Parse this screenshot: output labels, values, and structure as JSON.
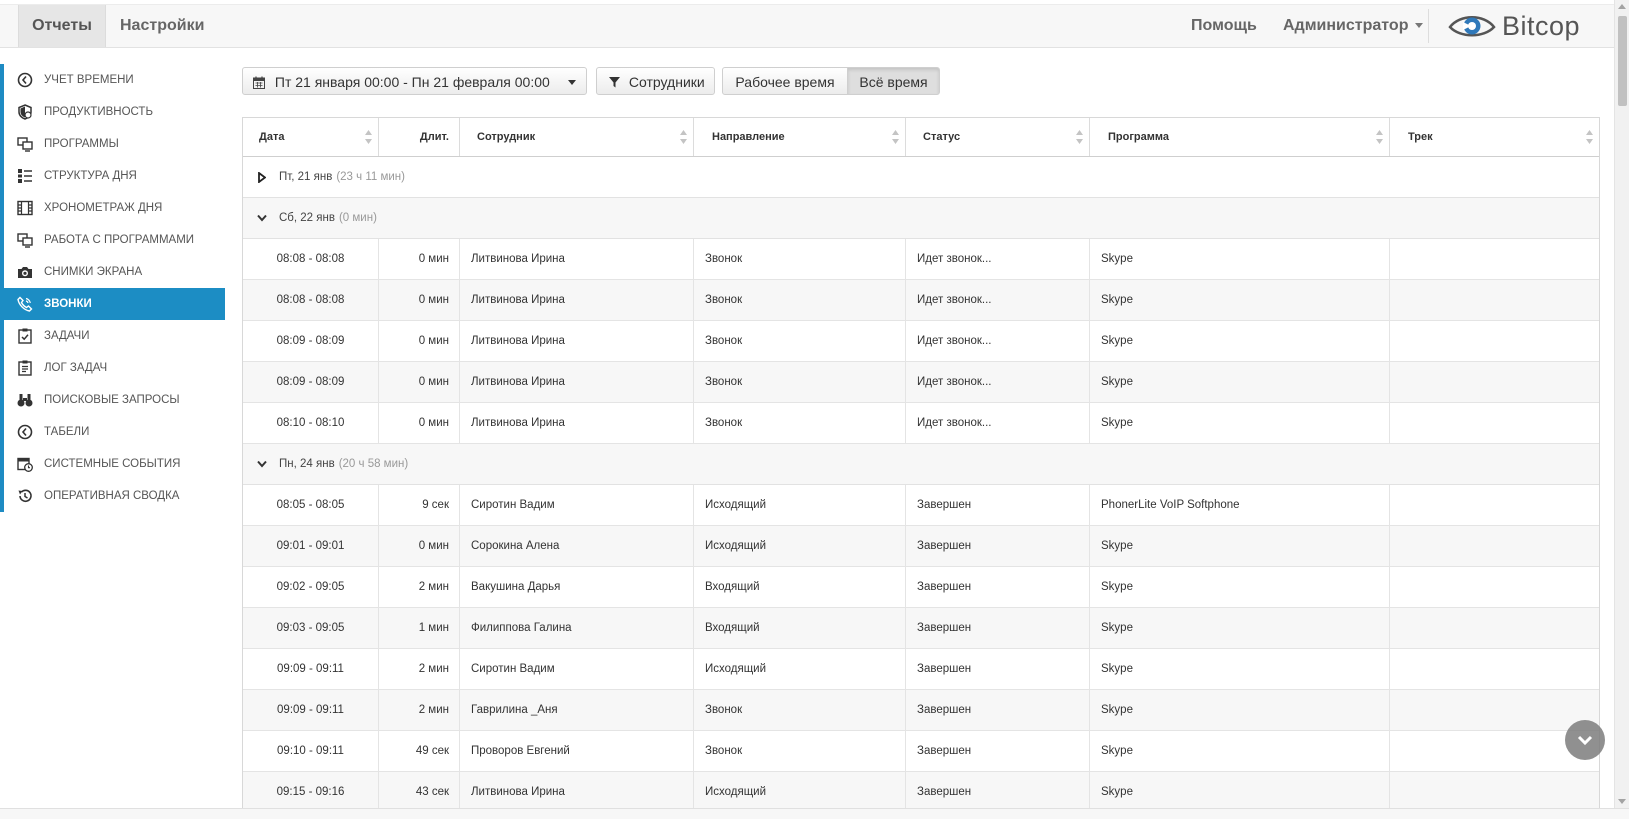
{
  "topnav": {
    "tabs": [
      {
        "label": "Отчеты",
        "active": true
      },
      {
        "label": "Настройки",
        "active": false
      }
    ],
    "help": "Помощь",
    "user": "Администратор",
    "brand": "Bitcop"
  },
  "sidebar": {
    "accent": "#1c8dc4",
    "items": [
      {
        "label": "УЧЕТ ВРЕМЕНИ",
        "icon": "clock-icon"
      },
      {
        "label": "ПРОДУКТИВНОСТЬ",
        "icon": "shield-icon"
      },
      {
        "label": "ПРОГРАММЫ",
        "icon": "monitors-icon"
      },
      {
        "label": "СТРУКТУРА ДНЯ",
        "icon": "structure-icon"
      },
      {
        "label": "ХРОНОМЕТРАЖ ДНЯ",
        "icon": "film-icon"
      },
      {
        "label": "РАБОТА С ПРОГРАММАМИ",
        "icon": "monitors-icon"
      },
      {
        "label": "СНИМКИ ЭКРАНА",
        "icon": "camera-icon"
      },
      {
        "label": "ЗВОНКИ",
        "icon": "phone-icon",
        "active": true
      },
      {
        "label": "ЗАДАЧИ",
        "icon": "checklist-icon"
      },
      {
        "label": "ЛОГ ЗАДАЧ",
        "icon": "task-log-icon"
      },
      {
        "label": "ПОИСКОВЫЕ ЗАПРОСЫ",
        "icon": "binoculars-icon"
      },
      {
        "label": "ТАБЕЛИ",
        "icon": "clock-icon"
      },
      {
        "label": "СИСТЕМНЫЕ СОБЫТИЯ",
        "icon": "calendar-clock-icon"
      },
      {
        "label": "ОПЕРАТИВНАЯ СВОДКА",
        "icon": "history-icon"
      }
    ]
  },
  "filters": {
    "date_range": "Пт 21 января 00:00 - Пн 21 февраля 00:00",
    "employees": "Сотрудники",
    "worktime": "Рабочее время",
    "alltime": "Всё время"
  },
  "table": {
    "columns": [
      "Дата",
      "Длит.",
      "Сотрудник",
      "Направление",
      "Статус",
      "Программа",
      "Трек"
    ],
    "groups": [
      {
        "day": "Пт, 21 янв",
        "total": "(23 ч 11 мин)",
        "expanded": false,
        "rows": []
      },
      {
        "day": "Сб, 22 янв",
        "total": "(0 мин)",
        "expanded": true,
        "rows": [
          [
            "08:08 - 08:08",
            "0 мин",
            "Литвинова Ирина",
            "Звонок",
            "Идет звонок...",
            "Skype",
            ""
          ],
          [
            "08:08 - 08:08",
            "0 мин",
            "Литвинова Ирина",
            "Звонок",
            "Идет звонок...",
            "Skype",
            ""
          ],
          [
            "08:09 - 08:09",
            "0 мин",
            "Литвинова Ирина",
            "Звонок",
            "Идет звонок...",
            "Skype",
            ""
          ],
          [
            "08:09 - 08:09",
            "0 мин",
            "Литвинова Ирина",
            "Звонок",
            "Идет звонок...",
            "Skype",
            ""
          ],
          [
            "08:10 - 08:10",
            "0 мин",
            "Литвинова Ирина",
            "Звонок",
            "Идет звонок...",
            "Skype",
            ""
          ]
        ]
      },
      {
        "day": "Пн, 24 янв",
        "total": "(20 ч 58 мин)",
        "expanded": true,
        "rows": [
          [
            "08:05 - 08:05",
            "9 сек",
            "Сиротин Вадим",
            "Исходящий",
            "Завершен",
            "PhonerLite VoIP Softphone",
            ""
          ],
          [
            "09:01 - 09:01",
            "0 мин",
            "Сорокина Алена",
            "Исходящий",
            "Завершен",
            "Skype",
            ""
          ],
          [
            "09:02 - 09:05",
            "2 мин",
            "Вакушина Дарья",
            "Входящий",
            "Завершен",
            "Skype",
            ""
          ],
          [
            "09:03 - 09:05",
            "1 мин",
            "Филиппова Галина",
            "Входящий",
            "Завершен",
            "Skype",
            ""
          ],
          [
            "09:09 - 09:11",
            "2 мин",
            "Сиротин Вадим",
            "Исходящий",
            "Завершен",
            "Skype",
            ""
          ],
          [
            "09:09 - 09:11",
            "2 мин",
            "Гаврилина _Аня",
            "Звонок",
            "Завершен",
            "Skype",
            ""
          ],
          [
            "09:10 - 09:11",
            "49 сек",
            "Проворов Евгений",
            "Звонок",
            "Завершен",
            "Skype",
            ""
          ],
          [
            "09:15 - 09:16",
            "43 сек",
            "Литвинова Ирина",
            "Исходящий",
            "Завершен",
            "Skype",
            ""
          ]
        ]
      }
    ]
  }
}
